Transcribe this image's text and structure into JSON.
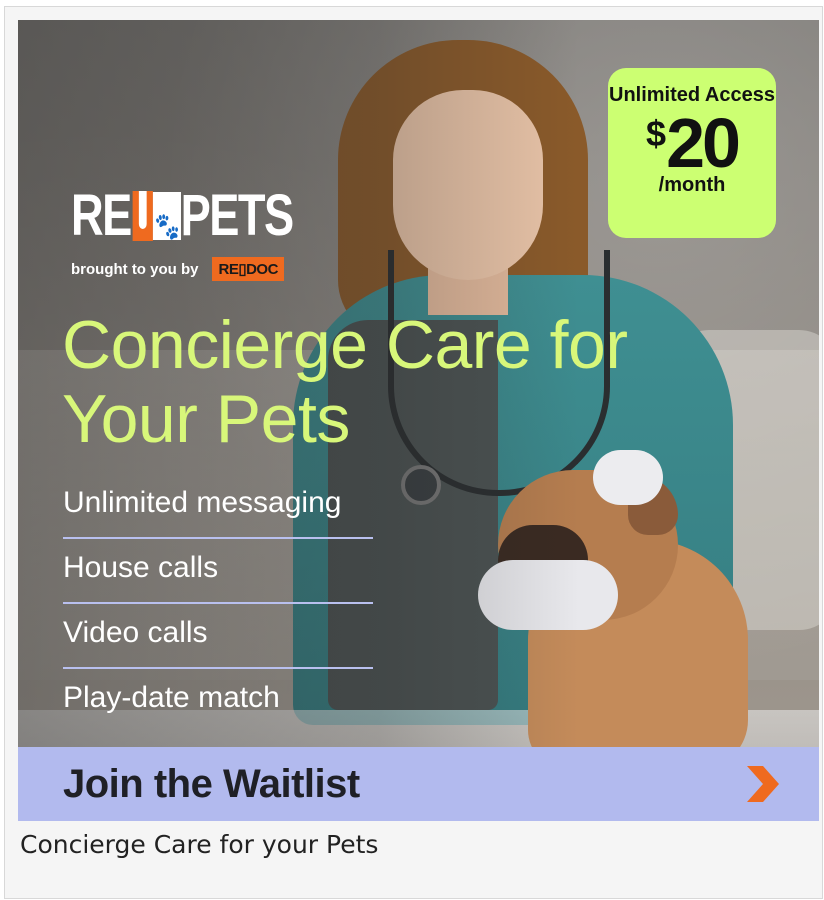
{
  "ad": {
    "logo_left": "RE",
    "logo_right": "PETS",
    "byline": "brought to you by",
    "byline_brand": "RE▯DOC",
    "headline": "Concierge Care for Your Pets",
    "features": [
      "Unlimited messaging",
      "House calls",
      "Video calls",
      "Play-date match"
    ],
    "badge": {
      "top": "Unlimited Access",
      "dollar": "$",
      "amount": "20",
      "period": "/month"
    },
    "cta_label": "Join the Waitlist",
    "cta_icon": "chevron-right-icon"
  },
  "caption": "Concierge Care for your Pets",
  "colors": {
    "headline": "#d8f77a",
    "badge_bg": "#ccff72",
    "cta_bg": "#b2baee",
    "accent": "#ef6a1f"
  }
}
